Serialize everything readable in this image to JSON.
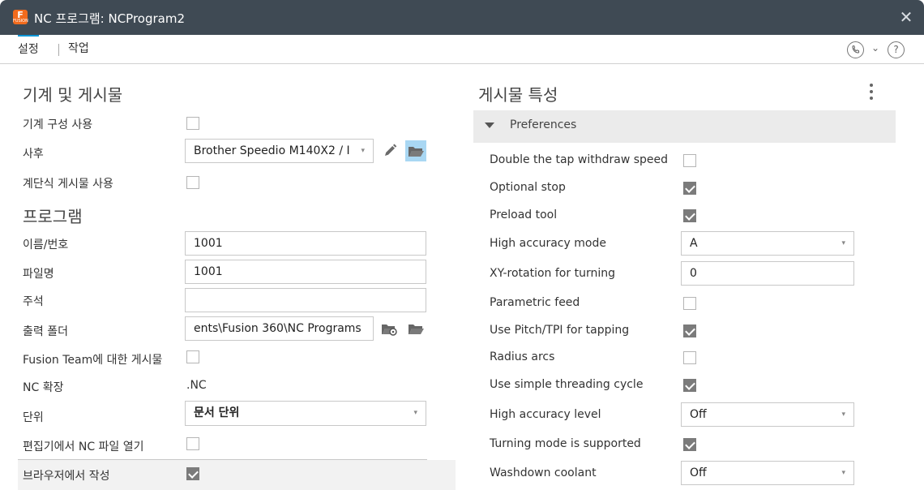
{
  "window": {
    "title": "NC 프로그램: NCProgram2",
    "app_icon_letter": "F",
    "app_icon_sub": "FUSION"
  },
  "tabs": [
    {
      "label": "설정"
    },
    {
      "label": "작업"
    }
  ],
  "left": {
    "section1_title": "기계 및 게시물",
    "machine_config_label": "기계 구성 사용",
    "post_label": "사후",
    "post_value": "Brother Speedio M140X2 / I",
    "staged_post_label": "계단식 게시물 사용",
    "section2_title": "프로그램",
    "name_label": "이름/번호",
    "name_value": "1001",
    "filename_label": "파일명",
    "filename_value": "1001",
    "comment_label": "주석",
    "comment_value": "",
    "output_folder_label": "출력 폴더",
    "output_folder_value": "ents\\Fusion 360\\NC Programs",
    "fusion_team_label": "Fusion Team에 대한 게시물",
    "nc_ext_label": "NC 확장",
    "nc_ext_value": ".NC",
    "unit_label": "단위",
    "unit_value": "문서 단위",
    "open_editor_label": "편집기에서 NC 파일 열기",
    "browser_label": "브라우저에서 작성"
  },
  "right": {
    "section_title": "게시물 특성",
    "group_label": "Preferences",
    "props": [
      {
        "label": "Double the tap withdraw speed",
        "type": "checkbox",
        "checked": false
      },
      {
        "label": "Optional stop",
        "type": "checkbox",
        "checked": true
      },
      {
        "label": "Preload tool",
        "type": "checkbox",
        "checked": true
      },
      {
        "label": "High accuracy mode",
        "type": "select",
        "value": "A"
      },
      {
        "label": "XY-rotation for turning",
        "type": "input",
        "value": "0"
      },
      {
        "label": "Parametric feed",
        "type": "checkbox",
        "checked": false
      },
      {
        "label": "Use Pitch/TPI for tapping",
        "type": "checkbox",
        "checked": true
      },
      {
        "label": "Radius arcs",
        "type": "checkbox",
        "checked": false
      },
      {
        "label": "Use simple threading cycle",
        "type": "checkbox",
        "checked": true
      },
      {
        "label": "High accuracy level",
        "type": "select",
        "value": "Off"
      },
      {
        "label": "Turning mode is supported",
        "type": "checkbox",
        "checked": true
      },
      {
        "label": "Washdown coolant",
        "type": "select",
        "value": "Off"
      }
    ]
  },
  "colors": {
    "titlebar": "#3f4a54",
    "accent_tab": "#0696d7",
    "checked": "#7b7b7b",
    "app_icon": "#f26b1d",
    "folder_highlight": "#a9d7f3"
  },
  "icons": [
    "app-icon",
    "close-icon",
    "phone-icon",
    "chevron-down-icon",
    "help-icon",
    "pencil-icon",
    "folder-open-icon",
    "folder-settings-icon",
    "kebab-menu-icon",
    "triangle-down-icon"
  ]
}
